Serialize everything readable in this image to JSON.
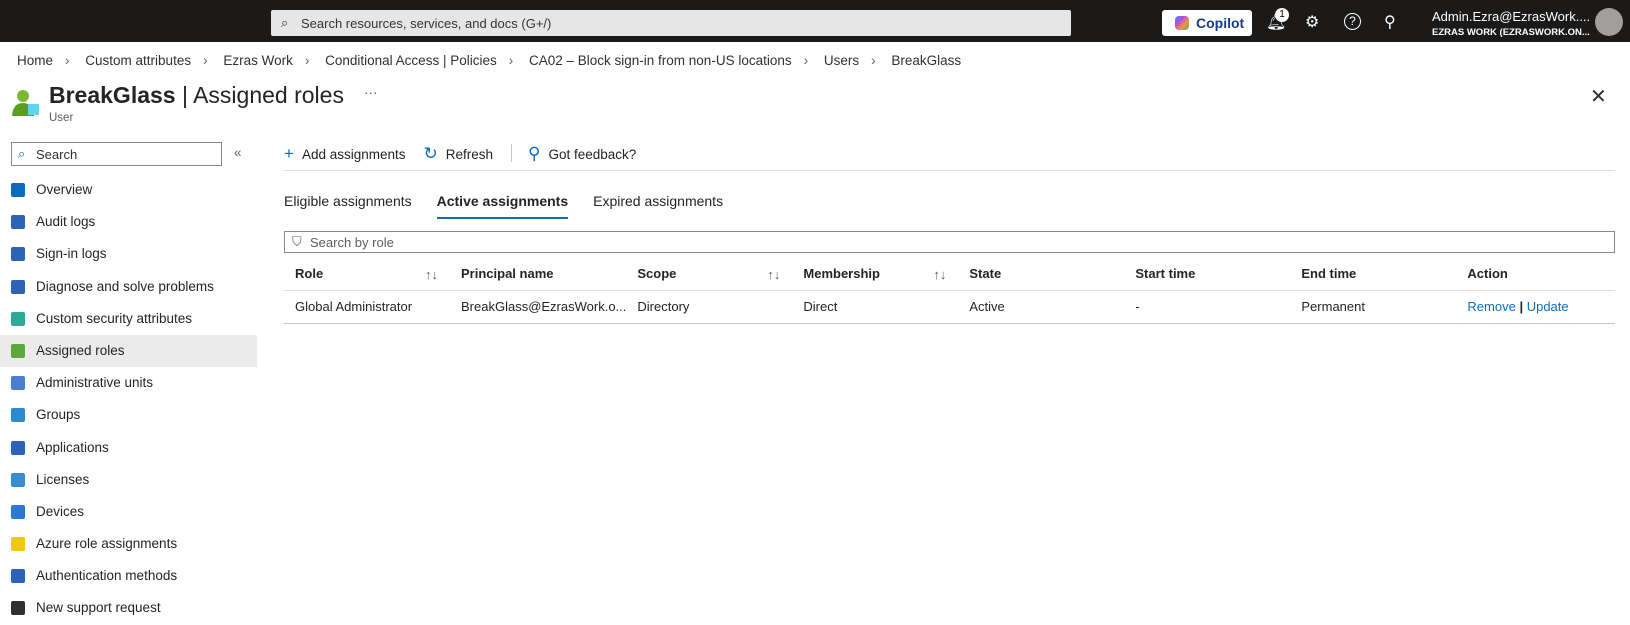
{
  "topbar": {
    "search_placeholder": "Search resources, services, and docs (G+/)",
    "copilot": "Copilot",
    "notification_count": "1",
    "account_name": "Admin.Ezra@EzrasWork....",
    "tenant": "EZRAS WORK (EZRASWORK.ON..."
  },
  "breadcrumb": [
    "Home",
    "Custom attributes",
    "Ezras Work",
    "Conditional Access | Policies",
    "CA02 – Block sign-in from non-US locations",
    "Users",
    "BreakGlass"
  ],
  "header": {
    "name": "BreakGlass",
    "page": "Assigned roles",
    "separator": "|",
    "subtitle": "User",
    "more": "···"
  },
  "sidebar": {
    "search_placeholder": "Search",
    "items": [
      {
        "label": "Overview",
        "icon": "user-icon",
        "color": "#0f6cbd"
      },
      {
        "label": "Audit logs",
        "icon": "audit-log-icon",
        "color": "#2b63b6"
      },
      {
        "label": "Sign-in logs",
        "icon": "sign-in-icon",
        "color": "#2b63b6"
      },
      {
        "label": "Diagnose and solve problems",
        "icon": "wrench-icon",
        "color": "#2b63b6"
      },
      {
        "label": "Custom security attributes",
        "icon": "attributes-icon",
        "color": "#2fa89a"
      },
      {
        "label": "Assigned roles",
        "icon": "assigned-roles-icon",
        "color": "#5da83a",
        "selected": true
      },
      {
        "label": "Administrative units",
        "icon": "admin-units-icon",
        "color": "#4a7fd0"
      },
      {
        "label": "Groups",
        "icon": "groups-icon",
        "color": "#2b8ad0"
      },
      {
        "label": "Applications",
        "icon": "applications-icon",
        "color": "#2b63b6"
      },
      {
        "label": "Licenses",
        "icon": "licenses-icon",
        "color": "#3a8fd0"
      },
      {
        "label": "Devices",
        "icon": "devices-icon",
        "color": "#2b79d0"
      },
      {
        "label": "Azure role assignments",
        "icon": "key-icon",
        "color": "#f2c811"
      },
      {
        "label": "Authentication methods",
        "icon": "shield-icon",
        "color": "#2b63b6"
      },
      {
        "label": "New support request",
        "icon": "support-icon",
        "color": "#323130"
      }
    ]
  },
  "toolbar": {
    "add": "Add assignments",
    "refresh": "Refresh",
    "feedback": "Got feedback?"
  },
  "tabs": [
    "Eligible assignments",
    "Active assignments",
    "Expired assignments"
  ],
  "active_tab": "Active assignments",
  "filter_placeholder": "Search by role",
  "table": {
    "columns": [
      "Role",
      "Principal name",
      "Scope",
      "Membership",
      "State",
      "Start time",
      "End time",
      "Action"
    ],
    "rows": [
      {
        "role": "Global Administrator",
        "principal": "BreakGlass@EzrasWork.o...",
        "scope": "Directory",
        "membership": "Direct",
        "state": "Active",
        "start": "-",
        "end": "Permanent",
        "remove": "Remove",
        "action_sep": "|",
        "update": "Update"
      }
    ]
  }
}
